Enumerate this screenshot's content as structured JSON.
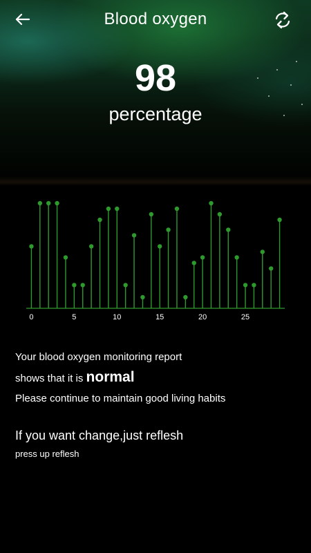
{
  "header": {
    "title": "Blood oxygen",
    "back_icon": "arrow-left-icon",
    "refresh_icon": "refresh-icon"
  },
  "reading": {
    "value": "98",
    "unit": "percentage"
  },
  "chart_data": {
    "type": "scatter",
    "style": "lollipop",
    "x_ticks": [
      0,
      5,
      10,
      15,
      20,
      25
    ],
    "x": [
      0,
      1,
      2,
      3,
      4,
      5,
      6,
      7,
      8,
      9,
      10,
      11,
      12,
      13,
      14,
      15,
      16,
      17,
      18,
      19,
      20,
      21,
      22,
      23,
      24,
      25,
      26,
      27,
      28,
      29
    ],
    "values": [
      56,
      95,
      95,
      95,
      46,
      21,
      21,
      56,
      80,
      90,
      90,
      21,
      66,
      10,
      85,
      56,
      71,
      90,
      10,
      41,
      46,
      95,
      85,
      71,
      46,
      21,
      21,
      51,
      36,
      80
    ],
    "ylim": [
      0,
      100
    ],
    "xlim": [
      -0.6,
      29.6
    ],
    "grid": false,
    "color": "#2e9a2e"
  },
  "report": {
    "line1": "Your blood oxygen monitoring report",
    "line2_prefix": "shows that it is",
    "status": "normal",
    "line3": "Please continue to maintain good living habits"
  },
  "hint": {
    "title": "If you want change,just reflesh",
    "subtitle": "press up reflesh"
  }
}
